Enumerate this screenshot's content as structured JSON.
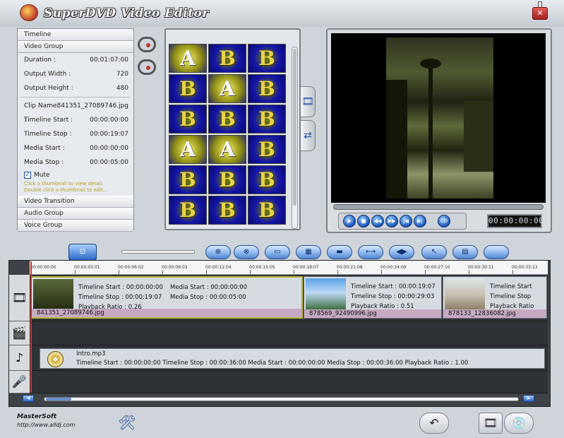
{
  "app": {
    "title": "SuperDVD Video Editor",
    "close_label": "✕"
  },
  "left_panel": {
    "groups": {
      "timeline": "Timeline",
      "video_group": "Video Group",
      "video_transition": "Video Transition",
      "audio_group": "Audio Group",
      "voice_group": "Voice Group"
    },
    "fields": [
      {
        "label": "Duration :",
        "value": "00:01:07:00"
      },
      {
        "label": "Output Width :",
        "value": "720"
      },
      {
        "label": "Output Height :",
        "value": "480"
      }
    ],
    "clip_name": {
      "label": "Clip Name :",
      "value": "841351_27089746.jpg"
    },
    "clip_fields": [
      {
        "label": "Timeline Start :",
        "value": "00:00:00:00"
      },
      {
        "label": "Timeline Stop :",
        "value": "00:00:19:07"
      },
      {
        "label": "Media Start :",
        "value": "00:00:00:00"
      },
      {
        "label": "Media Stop :",
        "value": "00:00:05:00"
      }
    ],
    "mute": {
      "label": "Mute",
      "checked": true
    },
    "hints": [
      "Click a thumbnail to view detail.",
      "Double click a thumbnail to edit..."
    ]
  },
  "gallery": {
    "letters": [
      "A",
      "B",
      "B",
      "B",
      "A",
      "B",
      "B",
      "B",
      "B",
      "A",
      "A",
      "B",
      "B",
      "B",
      "B",
      "B",
      "B",
      "B"
    ],
    "alt_tiles": [
      0,
      4,
      9,
      10
    ]
  },
  "preview": {
    "time": "00:00:00:00",
    "controls": [
      "▶",
      "■",
      "◀◀",
      "▶▶",
      "|◀",
      "▶|"
    ],
    "cd_label": "CD"
  },
  "toolbar": {
    "buttons": [
      "⊡",
      "⊕",
      "⊗",
      "▭",
      "▦",
      "▬",
      "⟷",
      "◀▶",
      "↖",
      "▤"
    ]
  },
  "timeline": {
    "ticks": [
      "00:00:00:00",
      "00:00:03:01",
      "00:00:06:02",
      "00:00:09:03",
      "00:00:12:04",
      "00:00:15:05",
      "00:00:18:07",
      "00:00:21:08",
      "00:00:24:09",
      "00:00:27:10",
      "00:00:30:11",
      "00:00:33:13"
    ],
    "video_clips": [
      {
        "name": "841351_27089746.jpg",
        "lines": [
          "Timeline Start : 00:00:00:00",
          "Timeline Stop : 00:00:19:07",
          "Playback Ratio : 0.26"
        ],
        "lines2": [
          "Media Start : 00:00:00:00",
          "Media Stop : 00:00:05:00"
        ]
      },
      {
        "name": "878569_92490996.jpg",
        "lines": [
          "Timeline Start : 00:00:19:07",
          "Timeline Stop : 00:00:29:03",
          "Playback Ratio : 0.51"
        ]
      },
      {
        "name": "878133_12836082.jpg",
        "lines": [
          "Timeline Start",
          "Timeline Stop",
          "Playback Ratio"
        ]
      }
    ],
    "audio_clip": {
      "name": "Intro.mp3",
      "info": "Timeline Start : 00:00:00:00   Timeline Stop : 00:00:36:00   Media Start : 00:00:00:00   Media Stop : 00:00:36:00   Playback Ratio : 1.00"
    }
  },
  "footer": {
    "company": "MasterSoft",
    "url": "http://www.alldj.com"
  },
  "colors": {
    "accent": "#2a68c7",
    "selection": "#b8b83c",
    "clip_name_bar": "#c6a9c2"
  }
}
